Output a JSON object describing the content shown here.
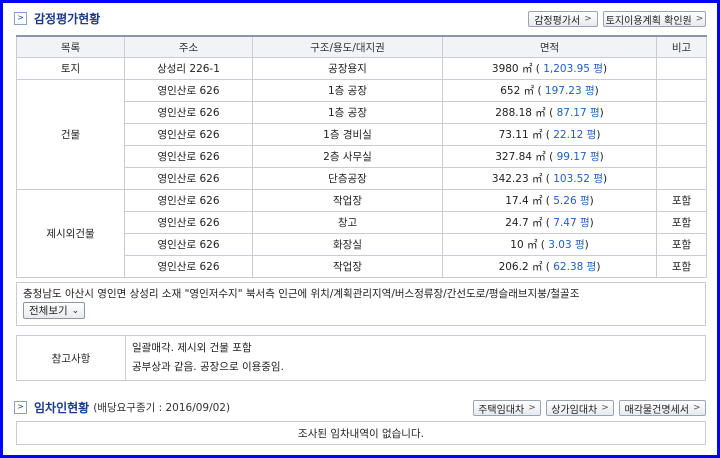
{
  "appraisal": {
    "title": "감정평가현황",
    "buttons": {
      "appraisal_report": "감정평가서",
      "land_plan": "토지이용계획 확인원"
    },
    "headers": {
      "category": "목록",
      "address": "주소",
      "structure": "구조/용도/대지권",
      "area": "면적",
      "note": "비고"
    },
    "land": {
      "category": "토지",
      "address": "상성리 226-1",
      "structure": "공장용지",
      "area_m2": "3980 ㎡ (",
      "area_py": " 1,203.95 평",
      "area_close": ")",
      "note": ""
    },
    "building": {
      "category": "건물",
      "rows": [
        {
          "address": "영인산로 626",
          "structure": "1층 공장",
          "area_m2": "652 ㎡ (",
          "area_py": " 197.23 평",
          "area_close": ")",
          "note": ""
        },
        {
          "address": "영인산로 626",
          "structure": "1층 공장",
          "area_m2": "288.18 ㎡ (",
          "area_py": " 87.17 평",
          "area_close": ")",
          "note": ""
        },
        {
          "address": "영인산로 626",
          "structure": "1층 경비실",
          "area_m2": "73.11 ㎡ (",
          "area_py": " 22.12 평",
          "area_close": ")",
          "note": ""
        },
        {
          "address": "영인산로 626",
          "structure": "2층 사무실",
          "area_m2": "327.84 ㎡ (",
          "area_py": " 99.17 평",
          "area_close": ")",
          "note": ""
        },
        {
          "address": "영인산로 626",
          "structure": "단층공장",
          "area_m2": "342.23 ㎡ (",
          "area_py": " 103.52 평",
          "area_close": ")",
          "note": ""
        }
      ]
    },
    "excluded": {
      "category": "제시외건물",
      "rows": [
        {
          "address": "영인산로 626",
          "structure": "작업장",
          "area_m2": "17.4 ㎡ (",
          "area_py": " 5.26 평",
          "area_close": ")",
          "note": "포함"
        },
        {
          "address": "영인산로 626",
          "structure": "창고",
          "area_m2": "24.7 ㎡ (",
          "area_py": " 7.47 평",
          "area_close": ")",
          "note": "포함"
        },
        {
          "address": "영인산로 626",
          "structure": "화장실",
          "area_m2": "10 ㎡ (",
          "area_py": " 3.03 평",
          "area_close": ")",
          "note": "포함"
        },
        {
          "address": "영인산로 626",
          "structure": "작업장",
          "area_m2": "206.2 ㎡ (",
          "area_py": " 62.38 평",
          "area_close": ")",
          "note": "포함"
        }
      ]
    },
    "description": "충청남도 아산시 영인면 상성리 소재 \"영인저수지\" 북서측 인근에 위치/계획관리지역/버스정류장/간선도로/평슬래브지붕/철골조",
    "view_all": "전체보기",
    "reference": {
      "label": "참고사항",
      "line1": "일괄매각. 제시외 건물 포함",
      "line2": "공부상과 같음. 공장으로 이용중임."
    }
  },
  "tenant": {
    "title": "임차인현황",
    "subtitle": "(배당요구종기 : 2016/09/02)",
    "buttons": {
      "housing": "주택임대차",
      "commercial": "상가임대차",
      "sale_note": "매각물건명세서"
    },
    "empty_message": "조사된 임차내역이 없습니다."
  }
}
